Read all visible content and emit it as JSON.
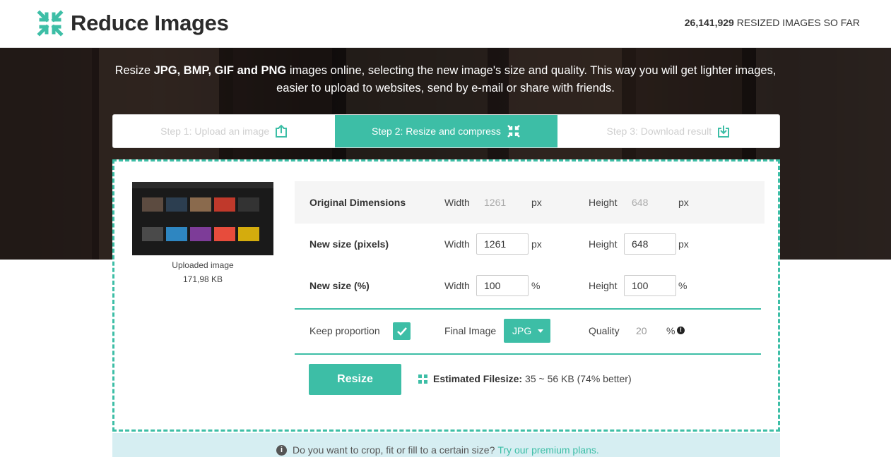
{
  "brand": {
    "name": "Reduce Images",
    "logo_icon": "compress-arrows-icon",
    "color": "#3dbea6"
  },
  "counter": {
    "value": "26,141,929",
    "suffix": "RESIZED IMAGES SO FAR"
  },
  "hero": {
    "intro_prefix": "Resize ",
    "formats": "JPG, BMP, GIF and PNG",
    "intro_rest": " images online, selecting the new image's size and quality. This way you will get lighter images, easier to upload to websites, send by e-mail or share with friends."
  },
  "steps": [
    {
      "label": "Step 1: Upload an image",
      "icon": "upload-icon",
      "active": false
    },
    {
      "label": "Step 2: Resize and compress",
      "icon": "compress-icon",
      "active": true
    },
    {
      "label": "Step 3: Download result",
      "icon": "download-icon",
      "active": false
    }
  ],
  "uploaded": {
    "caption": "Uploaded image",
    "size": "171,98 KB"
  },
  "form": {
    "original": {
      "label": "Original Dimensions",
      "width_label": "Width",
      "width": "1261",
      "width_unit": "px",
      "height_label": "Height",
      "height": "648",
      "height_unit": "px"
    },
    "new_pixels": {
      "label": "New size (pixels)",
      "width_label": "Width",
      "width": "1261",
      "width_unit": "px",
      "height_label": "Height",
      "height": "648",
      "height_unit": "px"
    },
    "new_percent": {
      "label": "New size (%)",
      "width_label": "Width",
      "width": "100",
      "width_unit": "%",
      "height_label": "Height",
      "height": "100",
      "height_unit": "%"
    },
    "keep_proportion": {
      "label": "Keep proportion",
      "checked": true
    },
    "final_image": {
      "label": "Final Image",
      "value": "JPG"
    },
    "quality": {
      "label": "Quality",
      "value": "20",
      "unit": "%",
      "info_icon": "info-icon"
    }
  },
  "actions": {
    "resize_label": "Resize",
    "estimate_label": "Estimated Filesize:",
    "estimate_value": "35 ~ 56 KB (74% better)"
  },
  "premium": {
    "text": "Do you want to crop, fit or fill to a certain size?",
    "link": "Try our premium plans."
  }
}
